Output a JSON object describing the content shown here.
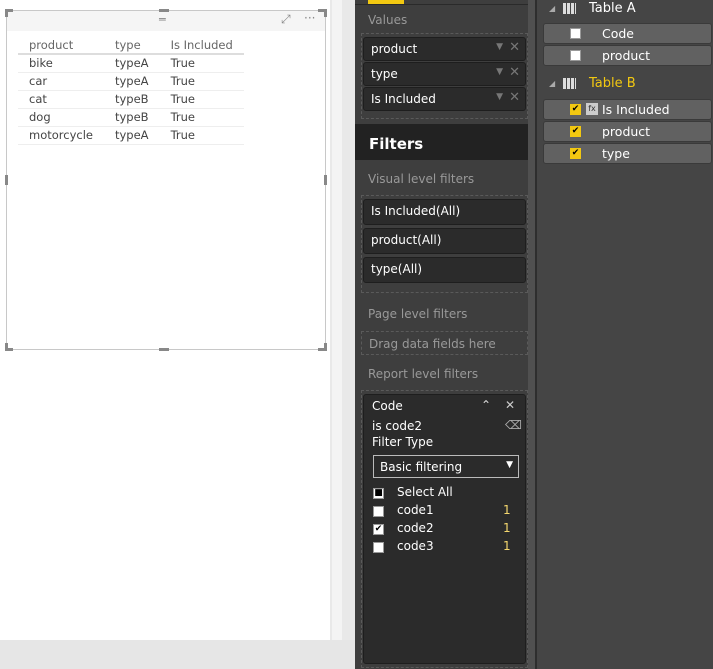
{
  "visual": {
    "columns": [
      "product",
      "type",
      "Is Included"
    ],
    "rows": [
      [
        "bike",
        "typeA",
        "True"
      ],
      [
        "car",
        "typeA",
        "True"
      ],
      [
        "cat",
        "typeB",
        "True"
      ],
      [
        "dog",
        "typeB",
        "True"
      ],
      [
        "motorcycle",
        "typeA",
        "True"
      ]
    ]
  },
  "values": {
    "label": "Values",
    "fields": [
      "product",
      "type",
      "Is Included"
    ]
  },
  "filters": {
    "title": "Filters",
    "visual_label": "Visual level filters",
    "visual_filters": [
      "Is Included(All)",
      "product(All)",
      "type(All)"
    ],
    "page_label": "Page level filters",
    "drop_hint": "Drag data fields here",
    "report_label": "Report level filters",
    "card": {
      "field": "Code",
      "summary": "is code2",
      "type_label": "Filter Type",
      "type_value": "Basic filtering",
      "items": [
        {
          "label": "Select All",
          "count": "",
          "state": "partial"
        },
        {
          "label": "code1",
          "count": "1",
          "state": "off"
        },
        {
          "label": "code2",
          "count": "1",
          "state": "on"
        },
        {
          "label": "code3",
          "count": "1",
          "state": "off"
        }
      ]
    }
  },
  "fields_panel": {
    "tables": [
      {
        "name": "Table A",
        "fields": [
          {
            "name": "Code",
            "checked": false
          },
          {
            "name": "product",
            "checked": false
          }
        ]
      },
      {
        "name": "Table B",
        "fields": [
          {
            "name": "Is Included",
            "checked": true
          },
          {
            "name": "product",
            "checked": true
          },
          {
            "name": "type",
            "checked": true
          }
        ]
      }
    ]
  },
  "colors": {
    "accent": "#f2c811",
    "panel": "#3e3e3e"
  }
}
